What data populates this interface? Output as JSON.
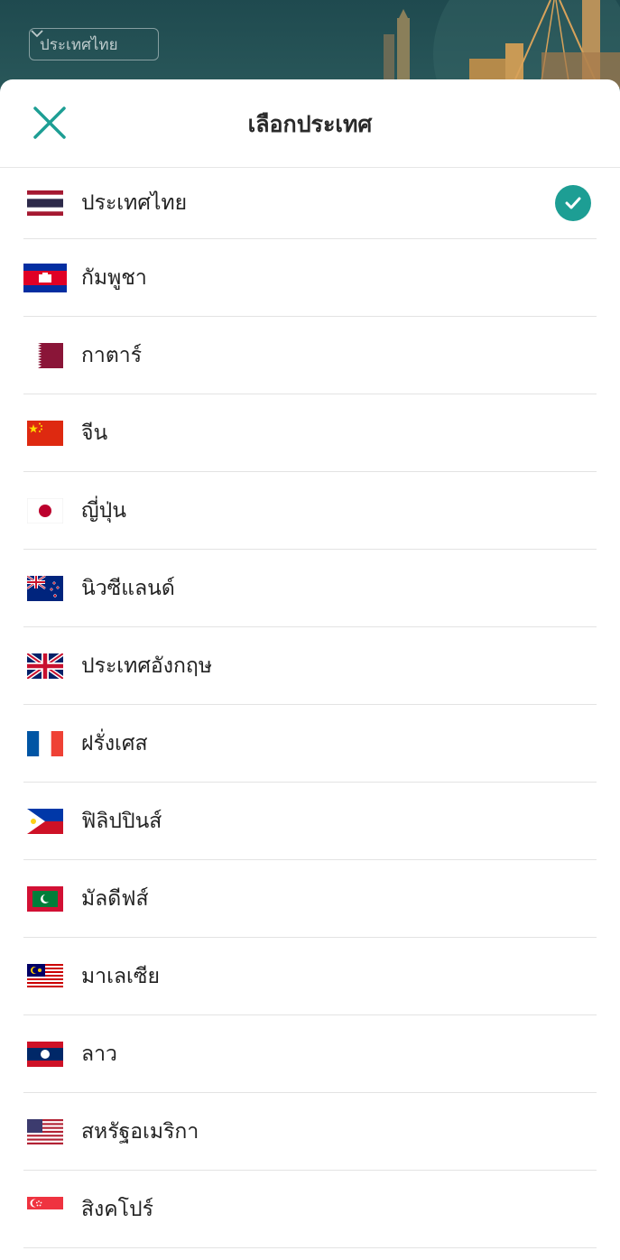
{
  "background": {
    "country_selector_label": "ประเทศไทย"
  },
  "sheet": {
    "title": "เลือกประเทศ"
  },
  "countries": [
    {
      "label": "ประเทศไทย",
      "flag": "thailand-flag",
      "selected": true
    },
    {
      "label": "กัมพูชา",
      "flag": "cambodia-flag",
      "selected": false
    },
    {
      "label": "กาตาร์",
      "flag": "qatar-flag",
      "selected": false
    },
    {
      "label": "จีน",
      "flag": "china-flag",
      "selected": false
    },
    {
      "label": "ญี่ปุ่น",
      "flag": "japan-flag",
      "selected": false
    },
    {
      "label": "นิวซีแลนด์",
      "flag": "new-zealand-flag",
      "selected": false
    },
    {
      "label": "ประเทศอังกฤษ",
      "flag": "united-kingdom-flag",
      "selected": false
    },
    {
      "label": "ฝรั่งเศส",
      "flag": "france-flag",
      "selected": false
    },
    {
      "label": "ฟิลิปปินส์",
      "flag": "philippines-flag",
      "selected": false
    },
    {
      "label": "มัลดีฟส์",
      "flag": "maldives-flag",
      "selected": false
    },
    {
      "label": "มาเลเซีย",
      "flag": "malaysia-flag",
      "selected": false
    },
    {
      "label": "ลาว",
      "flag": "laos-flag",
      "selected": false
    },
    {
      "label": "สหรัฐอเมริกา",
      "flag": "usa-flag",
      "selected": false
    },
    {
      "label": "สิงคโปร์",
      "flag": "singapore-flag",
      "selected": false
    }
  ],
  "colors": {
    "accent": "#1d9e94",
    "background_header": "#1f4a4f"
  }
}
